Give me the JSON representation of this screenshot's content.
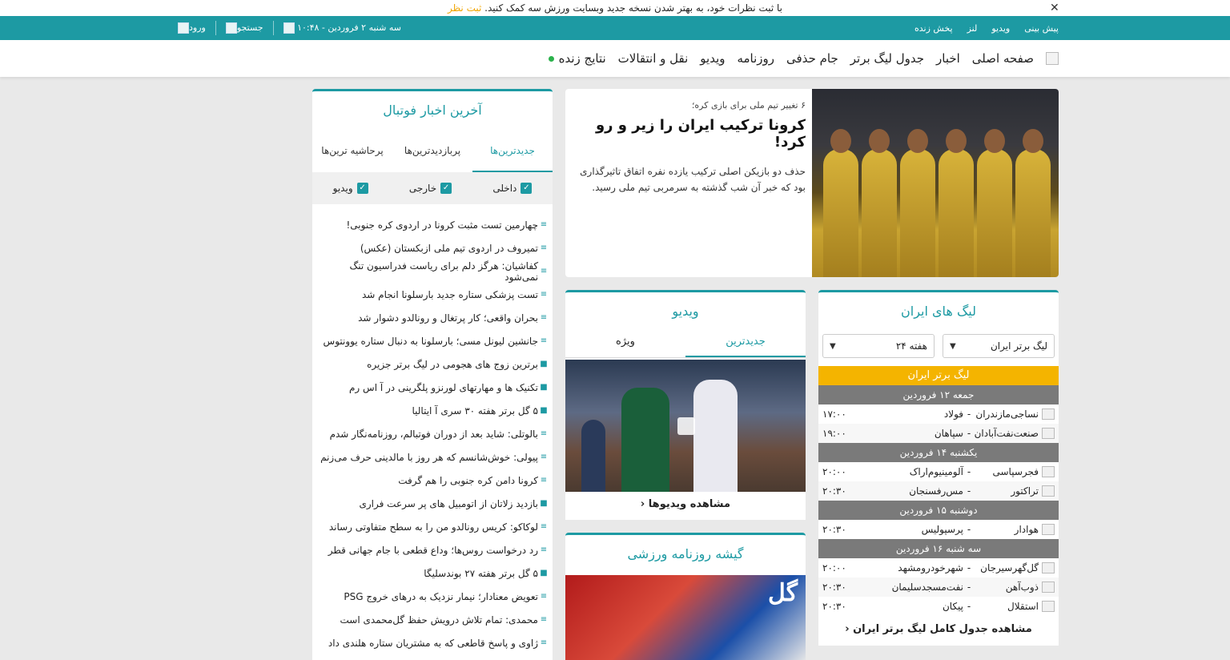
{
  "feedback_bar": {
    "message": "با ثبت نظرات خود، به بهتر شدن نسخه جدید وبسایت ورزش سه کمک کنید.",
    "link_label": "ثبت نظر",
    "close_label": "✕"
  },
  "topbar": {
    "links": [
      "پیش بینی",
      "ویدیو",
      "لنز",
      "پخش زنده"
    ],
    "datetime": "سه شنبه ۲ فروردین - ۱۰:۴۸",
    "search_label": "جستجو",
    "login_label": "ورود"
  },
  "main_nav": {
    "items": [
      "صفحه اصلی",
      "اخبار",
      "جدول لیگ برتر",
      "جام حذفی",
      "روزنامه",
      "ویدیو",
      "نقل و انتقالات",
      "نتایج زنده"
    ]
  },
  "headline": {
    "kicker": "۶ تغییر تیم ملی برای بازی کره؛",
    "title": "کرونا ترکیب ایران را زیر و رو کرد!",
    "lead": "حذف دو بازیکن اصلی ترکیب یازده نفره اتفاق تاثیرگذاری بود که خبر آن شب گذشته به سرمربی تیم ملی رسید."
  },
  "latest_news": {
    "title": "آخرین اخبار فوتبال",
    "tabs": [
      "جدیدترین‌ها",
      "پربازدیدترین‌ها",
      "پرحاشیه ترین‌ها"
    ],
    "filters": [
      "داخلی",
      "خارجی",
      "ویدیو"
    ],
    "items": [
      {
        "text": "چهارمین تست مثبت کرونا در اردوی کره جنوبی!",
        "icon": "text-icon"
      },
      {
        "text": "تمیروف در اردوی تیم ملی ازبکستان (عکس)",
        "icon": "text-icon"
      },
      {
        "text": "کفاشیان: هرگز دلم برای ریاست فدراسیون تنگ نمی‌شود",
        "icon": "text-icon"
      },
      {
        "text": "تست پزشکی ستاره جدید بارسلونا انجام شد",
        "icon": "text-icon"
      },
      {
        "text": "بحران واقعی؛ کار پرتغال و رونالدو دشوار شد",
        "icon": "text-icon"
      },
      {
        "text": "جانشین لیونل مسی؛ بارسلونا به دنبال ستاره یوونتوس",
        "icon": "text-icon"
      },
      {
        "text": "برترین زوج های هجومی در لیگ برتر جزیره",
        "icon": "video-icon"
      },
      {
        "text": "تکنیک ها و مهارتهای لورنزو پلگرینی در آ اس رم",
        "icon": "video-icon"
      },
      {
        "text": "۵ گل برتر هفته ۳۰ سری آ ایتالیا",
        "icon": "video-icon"
      },
      {
        "text": "بالوتلی: شاید بعد از دوران فوتبالم، روزنامه‌نگار شدم",
        "icon": "text-icon"
      },
      {
        "text": "پیولی: خوش‌شانسم که هر روز با مالدینی حرف می‌زنم",
        "icon": "text-icon"
      },
      {
        "text": "کرونا دامن کره جنوبی را هم گرفت",
        "icon": "text-icon"
      },
      {
        "text": "بازدید زلاتان از اتومبیل های پر سرعت فراری",
        "icon": "video-icon"
      },
      {
        "text": "لوکاکو: کریس رونالدو من را به سطح متفاوتی رساند",
        "icon": "text-icon"
      },
      {
        "text": "رد درخواست روس‌ها؛ وداع قطعی با جام جهانی قطر",
        "icon": "text-icon"
      },
      {
        "text": "۵ گل برتر هفته ۲۷ بوندسلیگا",
        "icon": "video-icon"
      },
      {
        "text": "تعویض معنادار؛ نیمار نزدیک به درهای خروج PSG",
        "icon": "text-icon"
      },
      {
        "text": "محمدی: تمام تلاش درویش حفظ گل‌محمدی است",
        "icon": "text-icon"
      },
      {
        "text": "ژاوی و پاسخ قاطعی که به مشتریان ستاره هلندی داد",
        "icon": "text-icon"
      }
    ]
  },
  "leagues": {
    "title": "لیگ های ایران",
    "league_select": "لیگ برتر ایران",
    "week_select": "هفته ۲۴",
    "league_name": "لیگ برتر ایران",
    "days": [
      {
        "label": "جمعه ۱۲ فروردین",
        "matches": [
          {
            "home": "نساجی‌مازندران",
            "away": "فولاد",
            "time": "۱۷:۰۰"
          },
          {
            "home": "صنعت‌نفت‌آبادان",
            "away": "سپاهان",
            "time": "۱۹:۰۰"
          }
        ]
      },
      {
        "label": "یکشنبه ۱۴ فروردین",
        "matches": [
          {
            "home": "فجرسپاسی",
            "away": "آلومینیوم‌اراک",
            "time": "۲۰:۰۰"
          },
          {
            "home": "تراکتور",
            "away": "مس‌رفسنجان",
            "time": "۲۰:۳۰"
          }
        ]
      },
      {
        "label": "دوشنبه ۱۵ فروردین",
        "matches": [
          {
            "home": "هوادار",
            "away": "پرسپولیس",
            "time": "۲۰:۳۰"
          }
        ]
      },
      {
        "label": "سه شنبه ۱۶ فروردین",
        "matches": [
          {
            "home": "گل‌گهرسیرجان",
            "away": "شهرخودرومشهد",
            "time": "۲۰:۰۰"
          },
          {
            "home": "ذوب‌آهن",
            "away": "نفت‌مسجدسلیمان",
            "time": "۲۰:۳۰"
          },
          {
            "home": "استقلال",
            "away": "پیکان",
            "time": "۲۰:۳۰"
          }
        ]
      }
    ],
    "more_label": "مشاهده جدول کامل لیگ برتر ایران"
  },
  "video": {
    "title": "ویدیو",
    "tabs": [
      "جدیدترین",
      "ویژه"
    ],
    "more_label": "مشاهده ویدیوها"
  },
  "newspaper": {
    "title": "گیشه روزنامه ورزشی",
    "masthead": "گل"
  },
  "colors": {
    "accent": "#1d9aa3",
    "league_bar": "#f4b400",
    "day_bar": "#7a7a7a",
    "live_dot": "#2bb24c"
  }
}
